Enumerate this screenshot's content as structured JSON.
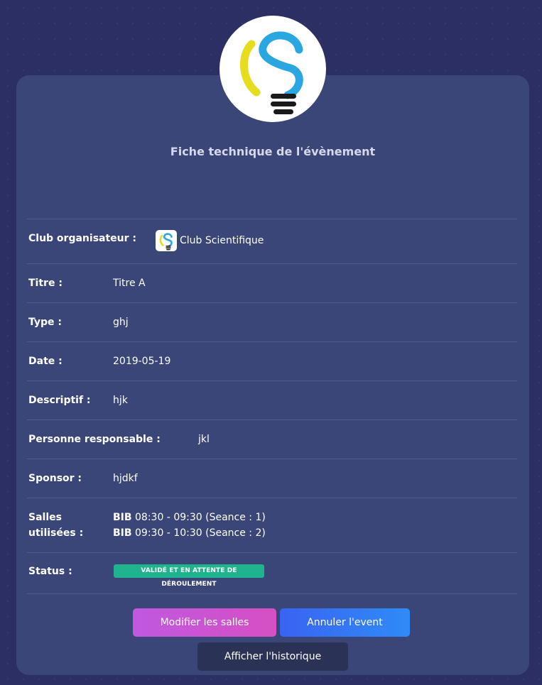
{
  "card": {
    "title": "Fiche technique de l'évènement"
  },
  "fields": {
    "club_label": "Club organisateur :",
    "club_value": "Club Scientifique",
    "title_label": "Titre :",
    "title_value": "Titre A",
    "type_label": "Type :",
    "type_value": "ghj",
    "date_label": "Date :",
    "date_value": "2019-05-19",
    "desc_label": "Descriptif :",
    "desc_value": "hjk",
    "resp_label": "Personne responsable :",
    "resp_value": "jkl",
    "sponsor_label": "Sponsor :",
    "sponsor_value": "hjdkf",
    "rooms_label_1": "Salles",
    "rooms_label_2": "utilisées :",
    "rooms": [
      {
        "room": "BIB",
        "detail": "08:30 - 09:30 (Seance : 1)"
      },
      {
        "room": "BIB",
        "detail": "09:30 - 10:30 (Seance : 2)"
      }
    ],
    "status_label": "Status :",
    "status_value": "VALIDÉ ET EN ATTENTE DE DÉROULEMENT"
  },
  "buttons": {
    "modify_rooms": "Modifier les salles",
    "cancel_event": "Annuler l'event",
    "show_history": "Afficher l'historique"
  },
  "colors": {
    "background": "#2b2f63",
    "card": "#3a4677",
    "status_badge": "#1fb38e",
    "modify_button": "#c058e0",
    "cancel_button": "#3a63f2",
    "history_button": "#2a3356"
  },
  "icons": {
    "club_logo": "lightbulb-s-logo"
  }
}
